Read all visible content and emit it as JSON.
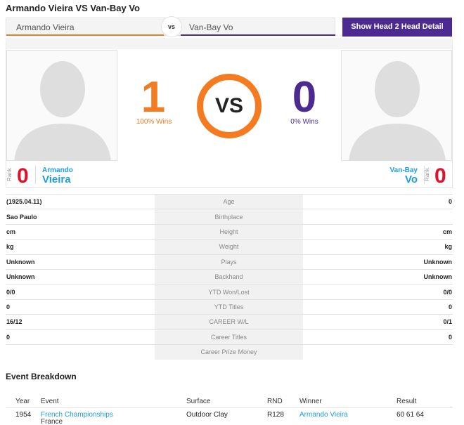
{
  "title": "Armando Vieira VS Van-Bay Vo",
  "selector": {
    "player1": "Armando Vieira",
    "vs": "vs",
    "player2": "Van-Bay Vo"
  },
  "h2h_button": "Show Head 2 Head Detail",
  "hero": {
    "p1_wins": "1",
    "p1_wins_label": "100% Wins",
    "vs": "VS",
    "p2_wins": "0",
    "p2_wins_label": "0% Wins"
  },
  "rank": {
    "word": "Rank",
    "p1_rank": "0",
    "p1_first": "Armando",
    "p1_last": "Vieira",
    "p2_rank": "0",
    "p2_first": "Van-Bay",
    "p2_last": "Vo"
  },
  "stats": [
    {
      "left": "(1925.04.11)",
      "label": "Age",
      "right": "0"
    },
    {
      "left": "Sao Paulo",
      "label": "Birthplace",
      "right": ""
    },
    {
      "left": "cm",
      "label": "Height",
      "right": "cm"
    },
    {
      "left": "kg",
      "label": "Weight",
      "right": "kg"
    },
    {
      "left": "Unknown",
      "label": "Plays",
      "right": "Unknown"
    },
    {
      "left": "Unknown",
      "label": "Backhand",
      "right": "Unknown"
    },
    {
      "left": "0/0",
      "label": "YTD Won/Lost",
      "right": "0/0"
    },
    {
      "left": "0",
      "label": "YTD Titles",
      "right": "0"
    },
    {
      "left": "16/12",
      "label": "CAREER W/L",
      "right": "0/1"
    },
    {
      "left": "0",
      "label": "Career Titles",
      "right": "0"
    },
    {
      "left": "",
      "label": "Career Prize Money",
      "right": ""
    }
  ],
  "event_breakdown": {
    "title": "Event Breakdown",
    "headers": {
      "year": "Year",
      "event": "Event",
      "surface": "Surface",
      "rnd": "RND",
      "winner": "Winner",
      "result": "Result"
    },
    "rows": [
      {
        "year": "1954",
        "event": "French Championships",
        "location": "France",
        "surface": "Outdoor Clay",
        "rnd": "R128",
        "winner": "Armando Vieira",
        "result": "60 61 64"
      }
    ]
  },
  "colors": {
    "accent_orange": "#f47b20",
    "accent_purple": "#4b2a92",
    "rank_red": "#e3102c",
    "link_blue": "#1e9de0"
  }
}
